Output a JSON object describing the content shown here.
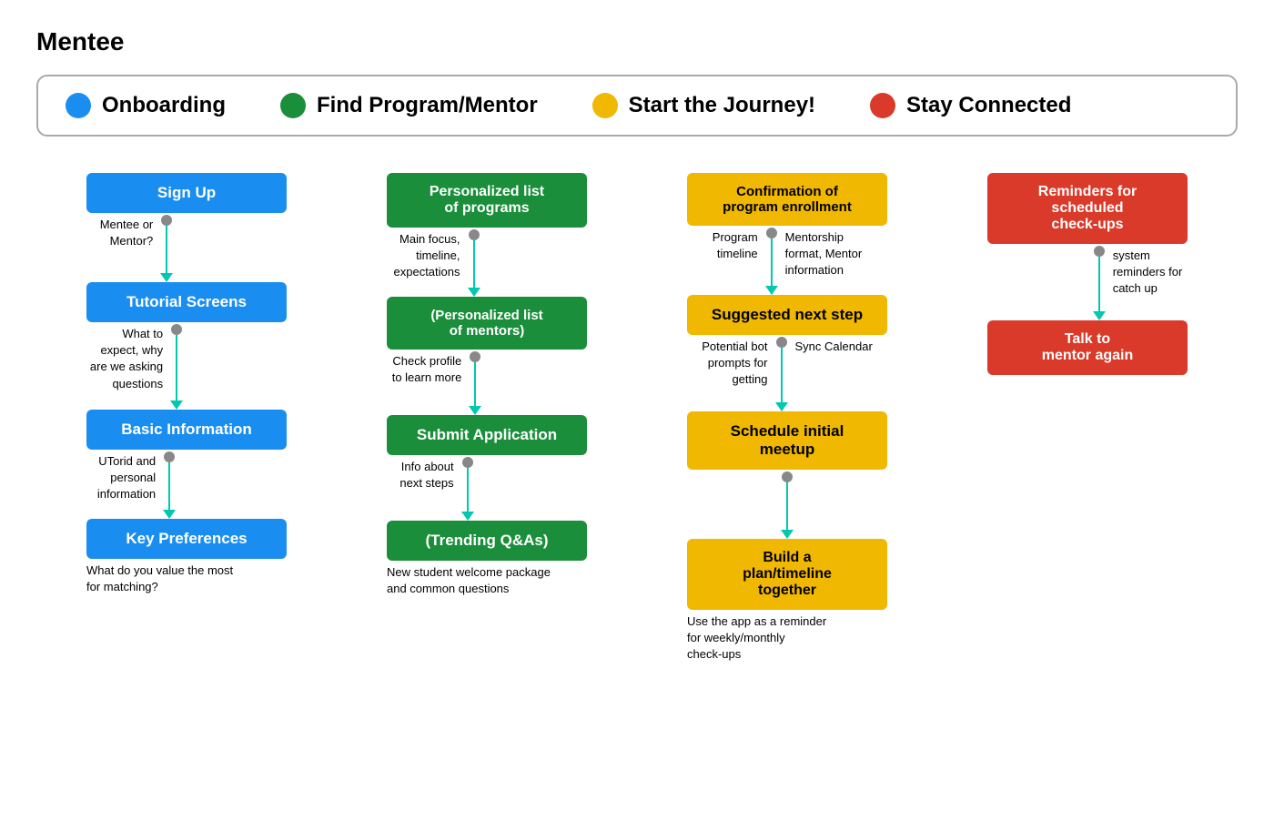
{
  "title": "Mentee",
  "legend": {
    "items": [
      {
        "label": "Onboarding",
        "color": "#1a8ef0"
      },
      {
        "label": "Find Program/Mentor",
        "color": "#1a8e3a"
      },
      {
        "label": "Start the Journey!",
        "color": "#f0b800"
      },
      {
        "label": "Stay Connected",
        "color": "#d93a2a"
      }
    ]
  },
  "columns": [
    {
      "name": "Onboarding",
      "steps": [
        {
          "box": "Sign Up",
          "color": "blue",
          "connector_note_left": "Mentee or\nMentor?",
          "line_height": 50
        },
        {
          "box": "Tutorial Screens",
          "color": "blue",
          "connector_note_left": "What to\nexpect, why\nare we asking\nquestions",
          "line_height": 80
        },
        {
          "box": "Basic Information",
          "color": "blue",
          "connector_note_left": "UTorid and\npersonal\ninformation",
          "line_height": 60
        },
        {
          "box": "Key Preferences",
          "color": "blue",
          "below_note": "What do you value the most\nfor matching?",
          "last": true
        }
      ]
    },
    {
      "name": "Find Program/Mentor",
      "steps": [
        {
          "box": "Personalized list\nof programs",
          "color": "green",
          "connector_note_left": "Main focus,\ntimeline,\nexpectations",
          "line_height": 60
        },
        {
          "box": "(Personalized list\nof mentors)",
          "color": "green",
          "connector_note_left": "Check profile\nto learn more",
          "line_height": 50
        },
        {
          "box": "Submit Application",
          "color": "green",
          "connector_note_left": "Info about\nnext steps",
          "line_height": 50
        },
        {
          "box": "(Trending Q&As)",
          "color": "green",
          "below_note": "New student welcome package\nand common questions",
          "last": true
        }
      ]
    },
    {
      "name": "Start the Journey",
      "steps": [
        {
          "box": "Confirmation of\nprogram enrollment",
          "color": "yellow",
          "connector_note_left": "Program\ntimeline",
          "connector_note_right": "Mentorship\nformat, Mentor\ninformation",
          "line_height": 50
        },
        {
          "box": "Suggested next step",
          "color": "yellow",
          "connector_note_left": "Potential bot\nprompts for\ngetting",
          "connector_note_right": "Sync Calendar",
          "line_height": 50
        },
        {
          "box": "Schedule initial\nmeetup",
          "color": "yellow",
          "line_height": 60
        },
        {
          "box": "Build a\nplan/timeline\ntogether",
          "color": "yellow",
          "below_note": "Use the app as a reminder\nfor weekly/monthly\ncheck-ups",
          "last": true
        }
      ]
    },
    {
      "name": "Stay Connected",
      "steps": [
        {
          "box": "Reminders for\nscheduled\ncheck-ups",
          "color": "red",
          "connector_note_right": "system\nreminders for\ncatch up",
          "line_height": 60
        },
        {
          "box": "Talk to\nmentor again",
          "color": "red",
          "last": true
        }
      ]
    }
  ]
}
